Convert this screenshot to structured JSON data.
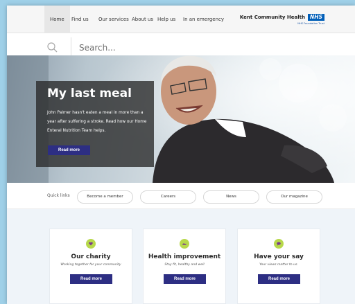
{
  "nav": {
    "items": [
      {
        "label": "Home"
      },
      {
        "label": "Find us"
      },
      {
        "label": "Our services"
      },
      {
        "label": "About us"
      },
      {
        "label": "Help us"
      },
      {
        "label": "In an emergency"
      }
    ],
    "brand": "Kent Community Health",
    "brand_badge": "NHS",
    "brand_sub": "NHS Foundation Trust"
  },
  "search": {
    "placeholder": "Search..."
  },
  "hero": {
    "title": "My last meal",
    "text": "John Palmer hasn't eaten a meal in more than a year after suffering a stroke. Read how our Home Enteral Nutrition Team helps.",
    "button": "Read more"
  },
  "quick_links": {
    "label": "Quick links",
    "items": [
      {
        "label": "Become a member"
      },
      {
        "label": "Careers"
      },
      {
        "label": "News"
      },
      {
        "label": "Our magazine"
      }
    ]
  },
  "cards": [
    {
      "title": "Our charity",
      "subtitle": "Working together for your community",
      "button": "Read more",
      "icon": "heart-icon"
    },
    {
      "title": "Health improvement",
      "subtitle": "Stay fit, healthy and well",
      "button": "Read more",
      "icon": "running-shoe-icon"
    },
    {
      "title": "Have your say",
      "subtitle": "Your views matter to us.",
      "button": "Read more",
      "icon": "speech-bubble-icon"
    }
  ],
  "colors": {
    "accent": "#2d2e83",
    "nhs_blue": "#005eb8",
    "icon_green": "#b7d84b"
  }
}
